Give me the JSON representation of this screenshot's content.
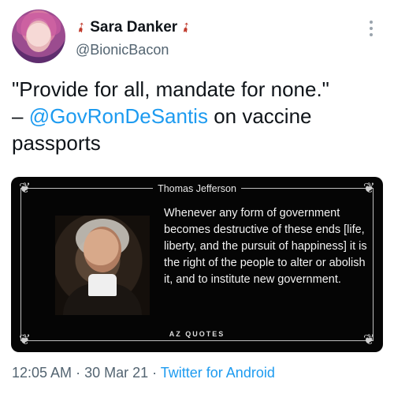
{
  "user": {
    "display_name": "Sara Danker",
    "handle": "@BionicBacon"
  },
  "tweet": {
    "line1": "\"Provide for all, mandate for none.\"",
    "dash": "– ",
    "mention": "@GovRonDeSantis",
    "rest": " on vaccine passports"
  },
  "quote_card": {
    "author": "Thomas Jefferson",
    "text": "Whenever any form of government becomes destructive of these ends [life, liberty, and the pursuit of happiness] it is the right of the people to alter or abolish it, and to institute new government.",
    "brand": "AZ QUOTES"
  },
  "meta": {
    "time": "12:05 AM",
    "separator1": " · ",
    "date": "30 Mar 21",
    "separator2": " · ",
    "source": "Twitter for Android"
  },
  "icons": {
    "name_decoration": "bacon-emoji",
    "more": "more-options-icon"
  }
}
